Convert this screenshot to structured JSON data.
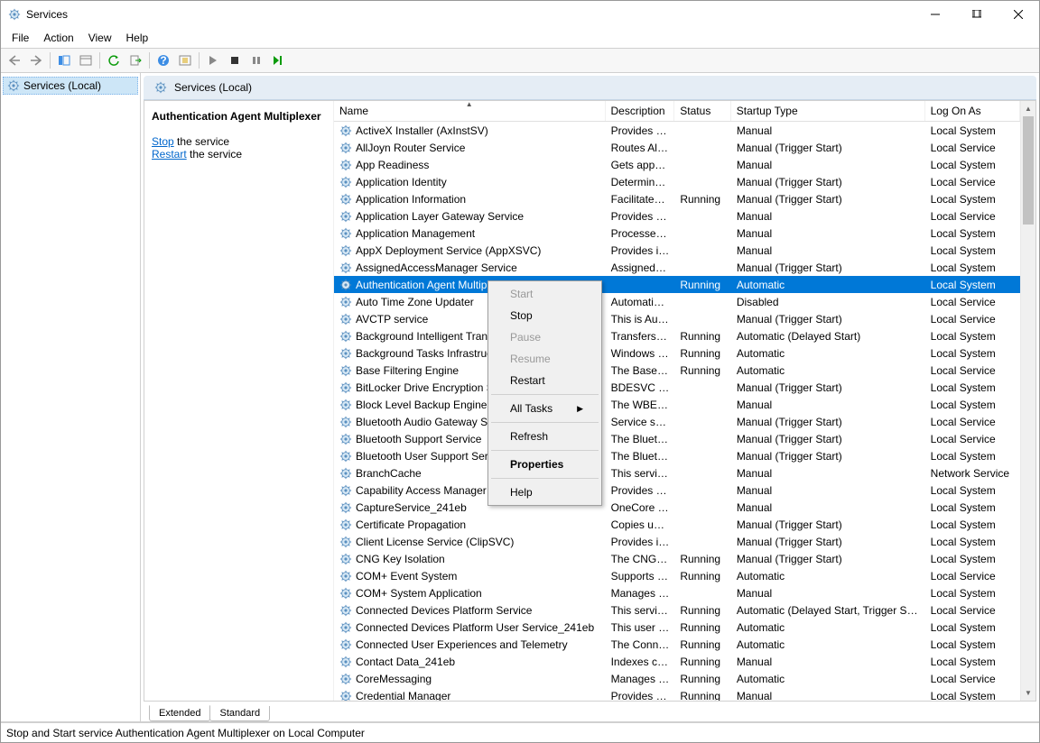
{
  "window": {
    "title": "Services"
  },
  "menubar": [
    "File",
    "Action",
    "View",
    "Help"
  ],
  "tree": {
    "root": "Services (Local)"
  },
  "main_header": "Services (Local)",
  "panel": {
    "selected_name": "Authentication Agent Multiplexer",
    "stop_link": "Stop",
    "stop_tail": " the service",
    "restart_link": "Restart",
    "restart_tail": " the service"
  },
  "columns": {
    "name": "Name",
    "desc": "Description",
    "status": "Status",
    "startup": "Startup Type",
    "logon": "Log On As"
  },
  "tabs": {
    "extended": "Extended",
    "standard": "Standard"
  },
  "statusbar": "Stop and Start service Authentication Agent Multiplexer on Local Computer",
  "context_menu": {
    "start": "Start",
    "stop": "Stop",
    "pause": "Pause",
    "resume": "Resume",
    "restart": "Restart",
    "all_tasks": "All Tasks",
    "refresh": "Refresh",
    "properties": "Properties",
    "help": "Help"
  },
  "services": [
    {
      "name": "ActiveX Installer (AxInstSV)",
      "desc": "Provides Us...",
      "status": "",
      "startup": "Manual",
      "logon": "Local System"
    },
    {
      "name": "AllJoyn Router Service",
      "desc": "Routes AllJo...",
      "status": "",
      "startup": "Manual (Trigger Start)",
      "logon": "Local Service"
    },
    {
      "name": "App Readiness",
      "desc": "Gets apps re...",
      "status": "",
      "startup": "Manual",
      "logon": "Local System"
    },
    {
      "name": "Application Identity",
      "desc": "Determines ...",
      "status": "",
      "startup": "Manual (Trigger Start)",
      "logon": "Local Service"
    },
    {
      "name": "Application Information",
      "desc": "Facilitates t...",
      "status": "Running",
      "startup": "Manual (Trigger Start)",
      "logon": "Local System"
    },
    {
      "name": "Application Layer Gateway Service",
      "desc": "Provides su...",
      "status": "",
      "startup": "Manual",
      "logon": "Local Service"
    },
    {
      "name": "Application Management",
      "desc": "Processes in...",
      "status": "",
      "startup": "Manual",
      "logon": "Local System"
    },
    {
      "name": "AppX Deployment Service (AppXSVC)",
      "desc": "Provides inf...",
      "status": "",
      "startup": "Manual",
      "logon": "Local System"
    },
    {
      "name": "AssignedAccessManager Service",
      "desc": "AssignedAc...",
      "status": "",
      "startup": "Manual (Trigger Start)",
      "logon": "Local System"
    },
    {
      "name": "Authentication Agent Multiplexer",
      "desc": "",
      "status": "Running",
      "startup": "Automatic",
      "logon": "Local System",
      "selected": true
    },
    {
      "name": "Auto Time Zone Updater",
      "desc": "Automatica...",
      "status": "",
      "startup": "Disabled",
      "logon": "Local Service"
    },
    {
      "name": "AVCTP service",
      "desc": "This is Audi...",
      "status": "",
      "startup": "Manual (Trigger Start)",
      "logon": "Local Service"
    },
    {
      "name": "Background Intelligent Transfer Service",
      "desc": "Transfers fil...",
      "status": "Running",
      "startup": "Automatic (Delayed Start)",
      "logon": "Local System"
    },
    {
      "name": "Background Tasks Infrastructure Service",
      "desc": "Windows in...",
      "status": "Running",
      "startup": "Automatic",
      "logon": "Local System"
    },
    {
      "name": "Base Filtering Engine",
      "desc": "The Base Fil...",
      "status": "Running",
      "startup": "Automatic",
      "logon": "Local Service"
    },
    {
      "name": "BitLocker Drive Encryption Service",
      "desc": "BDESVC hos...",
      "status": "",
      "startup": "Manual (Trigger Start)",
      "logon": "Local System"
    },
    {
      "name": "Block Level Backup Engine Service",
      "desc": "The WBENG...",
      "status": "",
      "startup": "Manual",
      "logon": "Local System"
    },
    {
      "name": "Bluetooth Audio Gateway Service",
      "desc": "Service sup...",
      "status": "",
      "startup": "Manual (Trigger Start)",
      "logon": "Local Service"
    },
    {
      "name": "Bluetooth Support Service",
      "desc": "The Bluetoo...",
      "status": "",
      "startup": "Manual (Trigger Start)",
      "logon": "Local Service"
    },
    {
      "name": "Bluetooth User Support Service_241eb",
      "desc": "The Bluetoo...",
      "status": "",
      "startup": "Manual (Trigger Start)",
      "logon": "Local System"
    },
    {
      "name": "BranchCache",
      "desc": "This service ...",
      "status": "",
      "startup": "Manual",
      "logon": "Network Service"
    },
    {
      "name": "Capability Access Manager Service",
      "desc": "Provides fac...",
      "status": "",
      "startup": "Manual",
      "logon": "Local System"
    },
    {
      "name": "CaptureService_241eb",
      "desc": "OneCore Ca...",
      "status": "",
      "startup": "Manual",
      "logon": "Local System"
    },
    {
      "name": "Certificate Propagation",
      "desc": "Copies user ...",
      "status": "",
      "startup": "Manual (Trigger Start)",
      "logon": "Local System"
    },
    {
      "name": "Client License Service (ClipSVC)",
      "desc": "Provides inf...",
      "status": "",
      "startup": "Manual (Trigger Start)",
      "logon": "Local System"
    },
    {
      "name": "CNG Key Isolation",
      "desc": "The CNG ke...",
      "status": "Running",
      "startup": "Manual (Trigger Start)",
      "logon": "Local System"
    },
    {
      "name": "COM+ Event System",
      "desc": "Supports Sy...",
      "status": "Running",
      "startup": "Automatic",
      "logon": "Local Service"
    },
    {
      "name": "COM+ System Application",
      "desc": "Manages th...",
      "status": "",
      "startup": "Manual",
      "logon": "Local System"
    },
    {
      "name": "Connected Devices Platform Service",
      "desc": "This service ...",
      "status": "Running",
      "startup": "Automatic (Delayed Start, Trigger Start)",
      "logon": "Local Service"
    },
    {
      "name": "Connected Devices Platform User Service_241eb",
      "desc": "This user se...",
      "status": "Running",
      "startup": "Automatic",
      "logon": "Local System"
    },
    {
      "name": "Connected User Experiences and Telemetry",
      "desc": "The Connec...",
      "status": "Running",
      "startup": "Automatic",
      "logon": "Local System"
    },
    {
      "name": "Contact Data_241eb",
      "desc": "Indexes con...",
      "status": "Running",
      "startup": "Manual",
      "logon": "Local System"
    },
    {
      "name": "CoreMessaging",
      "desc": "Manages co...",
      "status": "Running",
      "startup": "Automatic",
      "logon": "Local Service"
    },
    {
      "name": "Credential Manager",
      "desc": "Provides se...",
      "status": "Running",
      "startup": "Manual",
      "logon": "Local System"
    }
  ]
}
